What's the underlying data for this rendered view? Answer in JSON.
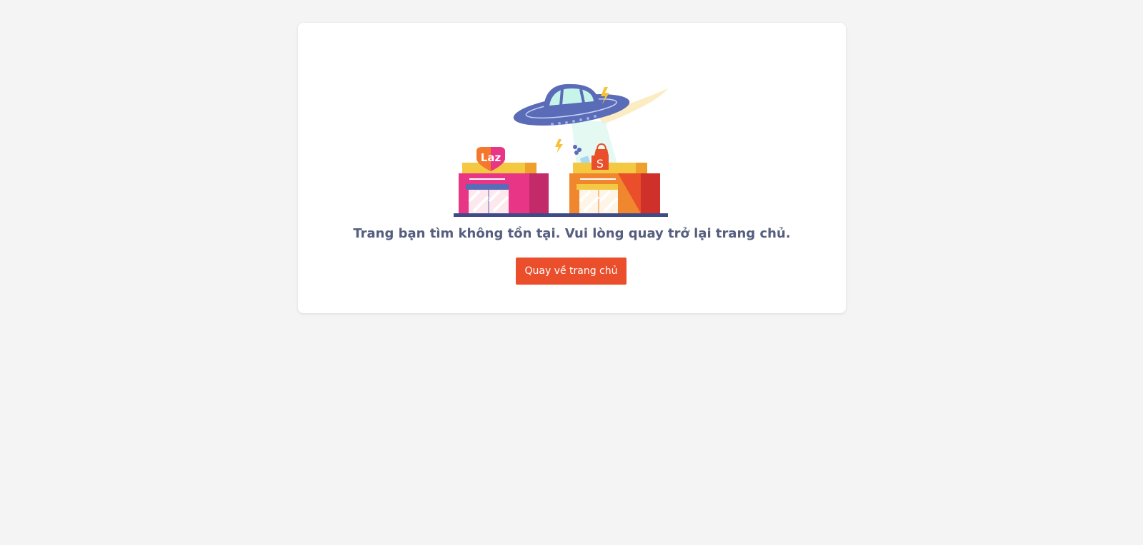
{
  "error": {
    "message": "Trang bạn tìm không tồn tại. Vui lòng quay trở lại trang chủ.",
    "button_label": "Quay về trang chủ"
  },
  "illustration": {
    "lazada_badge": "Laz",
    "shopee_badge": "S",
    "icons": [
      "ufo-icon",
      "lazada-store-icon",
      "shopee-store-icon",
      "lightning-icon"
    ]
  },
  "colors": {
    "background": "#f4f4f4",
    "card": "#ffffff",
    "text": "#555e7e",
    "button": "#ea4e2b",
    "button_text": "#ffffff"
  }
}
